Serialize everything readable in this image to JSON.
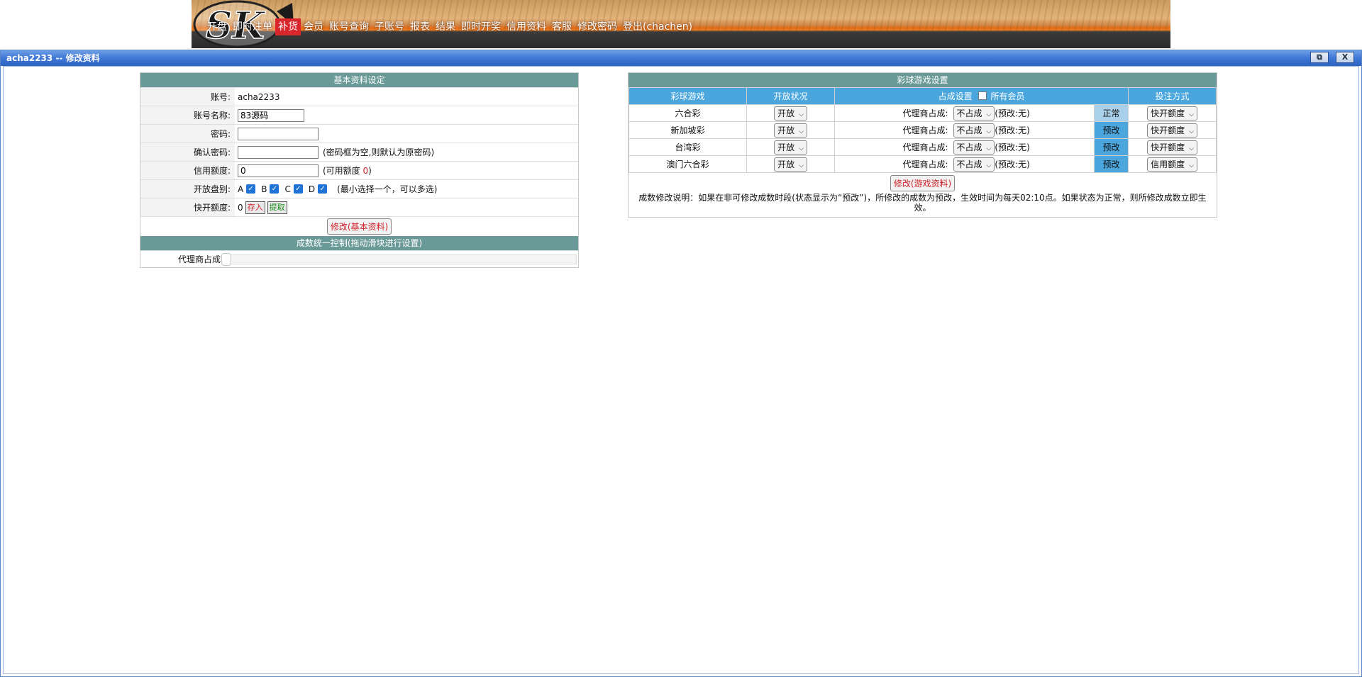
{
  "nav": {
    "items": [
      {
        "label": "开盘",
        "active": false
      },
      {
        "label": "即时注单",
        "active": false
      },
      {
        "label": "补货",
        "active": true
      },
      {
        "label": "会员",
        "active": false
      },
      {
        "label": "账号查询",
        "active": false
      },
      {
        "label": "子账号",
        "active": false
      },
      {
        "label": "报表",
        "active": false
      },
      {
        "label": "结果",
        "active": false
      },
      {
        "label": "即时开奖",
        "active": false
      },
      {
        "label": "信用资料",
        "active": false
      },
      {
        "label": "客服",
        "active": false
      },
      {
        "label": "修改密码",
        "active": false
      },
      {
        "label": "登出(chachen)",
        "active": false
      }
    ]
  },
  "dialog": {
    "title": "acha2233 -- 修改资料",
    "restore_glyph": "⧉",
    "close_glyph": "X"
  },
  "basic": {
    "header": "基本资料设定",
    "account_label": "账号:",
    "account_value": "acha2233",
    "name_label": "账号名称:",
    "name_value": "83源码",
    "password_label": "密码:",
    "password_value": "",
    "confirm_label": "确认密码:",
    "confirm_value": "",
    "password_hint": "(密码框为空,则默认为原密码)",
    "credit_label": "信用额度:",
    "credit_value": "0",
    "available_prefix": "(可用额度 ",
    "available_value": "0",
    "available_suffix": ")",
    "plates_label": "开放盘别:",
    "plates": [
      {
        "label": "A",
        "checked": true
      },
      {
        "label": "B",
        "checked": true
      },
      {
        "label": "C",
        "checked": true
      },
      {
        "label": "D",
        "checked": true
      }
    ],
    "plates_hint": "(最小选择一个，可以多选)",
    "quick_label": "快开额度:",
    "quick_value": "0",
    "deposit_label": "存入",
    "withdraw_label": "提取",
    "submit_label": "修改(基本资料)"
  },
  "share_control": {
    "header": "成数统一控制(拖动滑块进行设置)",
    "agent_label": "代理商占成",
    "slider_value": 0
  },
  "games": {
    "header": "彩球游戏设置",
    "col_game": "彩球游戏",
    "col_status": "开放状况",
    "col_share": "占成设置",
    "col_all_members": "所有会员",
    "col_bet": "投注方式",
    "share_label": "代理商占成:",
    "rows": [
      {
        "name": "六合彩",
        "status": "开放",
        "share": "不占成",
        "preset": "(预改:无)",
        "state": "正常",
        "bet": "快开额度"
      },
      {
        "name": "新加坡彩",
        "status": "开放",
        "share": "不占成",
        "preset": "(预改:无)",
        "state": "预改",
        "bet": "快开额度"
      },
      {
        "name": "台湾彩",
        "status": "开放",
        "share": "不占成",
        "preset": "(预改:无)",
        "state": "预改",
        "bet": "快开额度"
      },
      {
        "name": "澳门六合彩",
        "status": "开放",
        "share": "不占成",
        "preset": "(预改:无)",
        "state": "预改",
        "bet": "信用额度"
      }
    ],
    "submit_label": "修改(游戏资料)",
    "note": "成数修改说明：如果在非可修改成数时段(状态显示为“预改”)，所修改的成数为预改，生效时间为每天02:10点。如果状态为正常，则所修改成数立即生效。"
  }
}
